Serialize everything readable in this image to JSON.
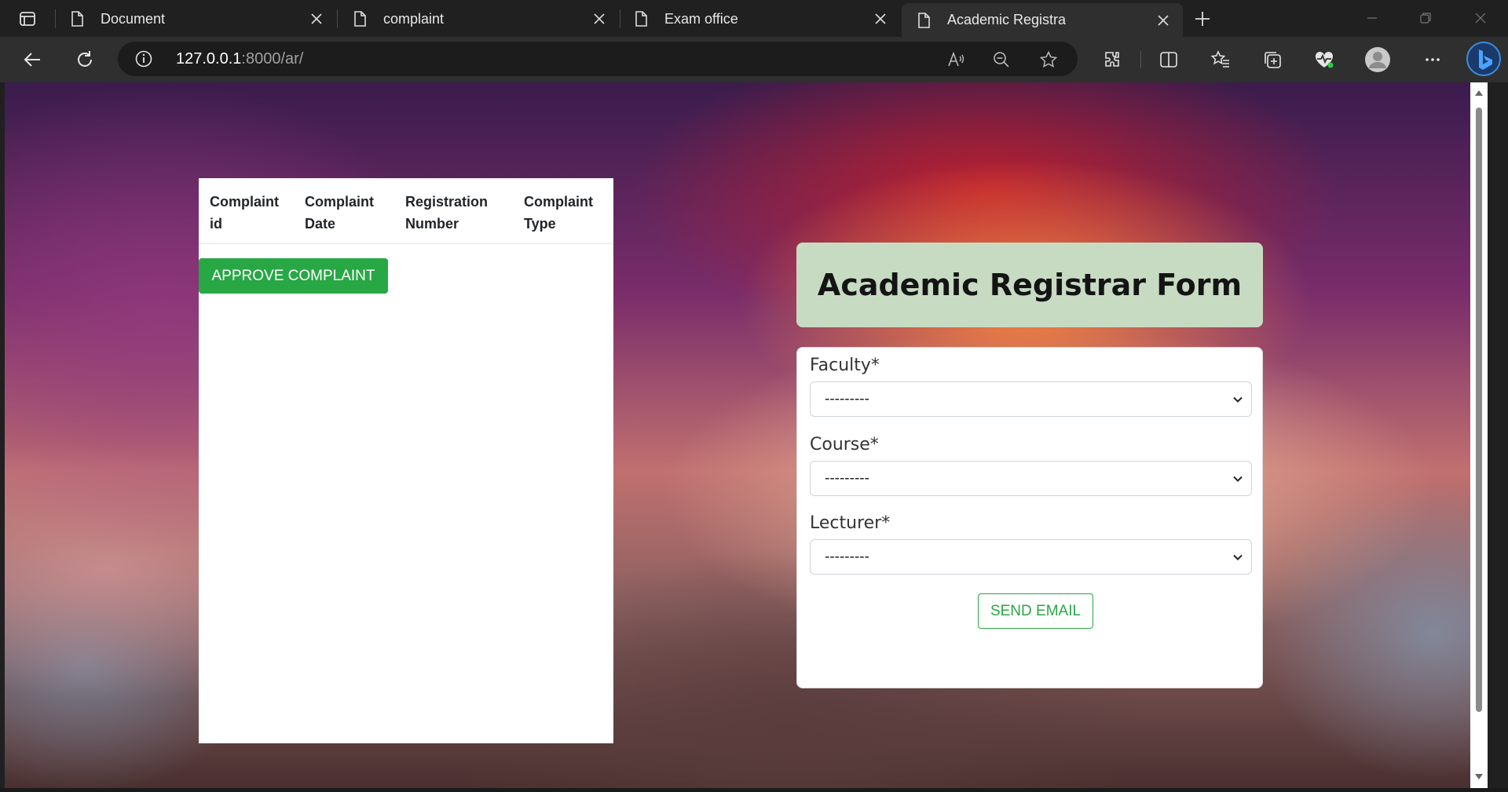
{
  "browser": {
    "tabs": [
      {
        "title": "Document"
      },
      {
        "title": "complaint"
      },
      {
        "title": "Exam office"
      },
      {
        "title": "Academic Registra"
      }
    ],
    "address": {
      "host": "127.0.0.1",
      "path": ":8000/ar/"
    }
  },
  "complaints_table": {
    "headers": [
      {
        "line1": "Complaint",
        "line2": "id"
      },
      {
        "line1": "Complaint",
        "line2": "Date"
      },
      {
        "line1": "Registration",
        "line2": "Number"
      },
      {
        "line1": "Complaint",
        "line2": "Type"
      }
    ],
    "approve_label": "APPROVE COMPLAINT"
  },
  "form": {
    "title": "Academic Registrar Form",
    "fields": [
      {
        "label": "Faculty*",
        "value": "---------"
      },
      {
        "label": "Course*",
        "value": "---------"
      },
      {
        "label": "Lecturer*",
        "value": "---------"
      }
    ],
    "submit_label": "SEND EMAIL"
  },
  "colors": {
    "success": "#28a745",
    "header_bg": "#c7dbc3",
    "chrome_bg": "#202020",
    "toolbar_bg": "#2f2f2f"
  }
}
